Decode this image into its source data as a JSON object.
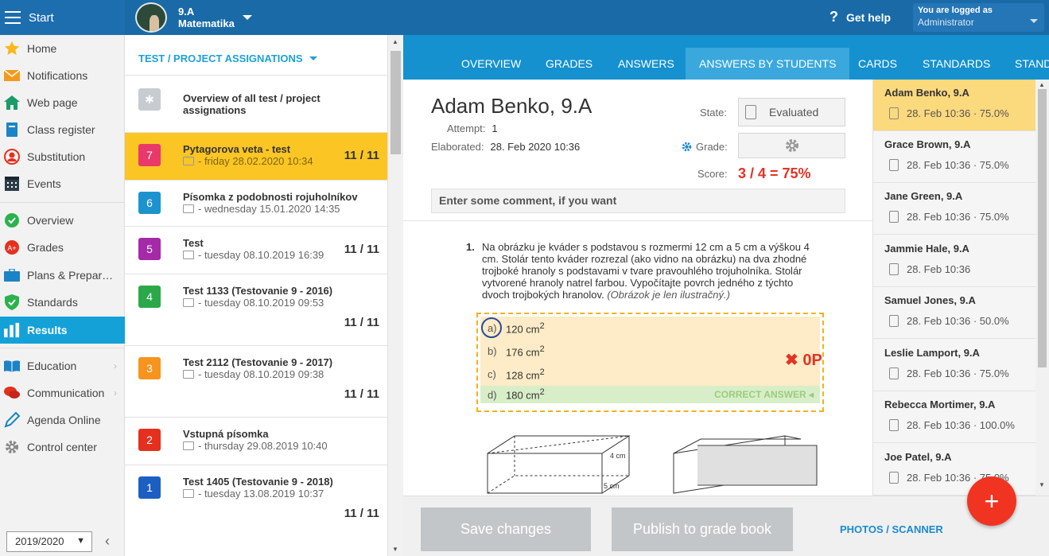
{
  "topbar": {
    "start_label": "Start",
    "class_name": "9.A",
    "subject": "Matematika",
    "help_label": "Get help",
    "logged_label": "You are logged as",
    "logged_user": "Administrator"
  },
  "sidebar": {
    "items": [
      {
        "label": "Home",
        "icon": "star-icon"
      },
      {
        "label": "Notifications",
        "icon": "envelope-icon"
      },
      {
        "label": "Web page",
        "icon": "house-icon"
      },
      {
        "label": "Class register",
        "icon": "book-icon"
      },
      {
        "label": "Substitution",
        "icon": "person-icon"
      },
      {
        "label": "Events",
        "icon": "calendar-icon"
      },
      {
        "label": "Overview",
        "icon": "check-circle-icon"
      },
      {
        "label": "Grades",
        "icon": "grade-icon"
      },
      {
        "label": "Plans & Preparations",
        "icon": "briefcase-icon"
      },
      {
        "label": "Standards",
        "icon": "shield-icon"
      },
      {
        "label": "Results",
        "icon": "bar-chart-icon"
      },
      {
        "label": "Education",
        "icon": "open-book-icon"
      },
      {
        "label": "Communication",
        "icon": "chat-icon"
      },
      {
        "label": "Agenda Online",
        "icon": "pencil-icon"
      },
      {
        "label": "Control center",
        "icon": "gear-icon"
      }
    ],
    "year": "2019/2020"
  },
  "list": {
    "header": "TEST / PROJECT ASSIGNATIONS",
    "overview": "Overview of all test / project assignations",
    "rows": [
      {
        "num": "7",
        "title": "Pytagorova veta - test",
        "sub": "- friday 28.02.2020 10:34",
        "score": "11 / 11"
      },
      {
        "num": "6",
        "title": "Písomka z podobnosti rojuholníkov",
        "sub": "- wednesday 15.01.2020 14:35",
        "score": ""
      },
      {
        "num": "5",
        "title": "Test",
        "sub": "- tuesday 08.10.2019 16:39",
        "score": "11 / 11"
      },
      {
        "num": "4",
        "title": "Test 1133 (Testovanie 9 - 2016)",
        "sub": "- tuesday 08.10.2019 09:53",
        "score": "11 / 11"
      },
      {
        "num": "3",
        "title": "Test 2112 (Testovanie 9 - 2017)",
        "sub": "- tuesday 08.10.2019 09:38",
        "score": "11 / 11"
      },
      {
        "num": "2",
        "title": "Vstupná písomka",
        "sub": "- thursday 29.08.2019 10:40",
        "score": ""
      },
      {
        "num": "1",
        "title": "Test 1405 (Testovanie 9 - 2018)",
        "sub": "- tuesday 13.08.2019 10:37",
        "score": "11 / 11"
      }
    ],
    "colors": [
      "#e9386a",
      "#1c93cf",
      "#a42aa8",
      "#2ba84a",
      "#f7941d",
      "#e5301f",
      "#1d5ec3"
    ]
  },
  "tabs": [
    "OVERVIEW",
    "GRADES",
    "ANSWERS",
    "ANSWERS BY STUDENTS",
    "CARDS",
    "STANDARDS",
    "STAND"
  ],
  "detail": {
    "name": "Adam Benko, 9.A",
    "attempt_label": "Attempt:",
    "attempt": "1",
    "elaborated_label": "Elaborated:",
    "elaborated": "28. Feb 2020 10:36",
    "state_label": "State:",
    "state": "Evaluated",
    "grade_label": "Grade:",
    "score_label": "Score:",
    "score": "3 / 4 = 75%",
    "comment_placeholder": "Enter some comment, if you want"
  },
  "question": {
    "num": "1.",
    "text": "Na obrázku je kváder s podstavou s rozmermi 12 cm a 5 cm a výškou 4 cm. Stolár tento kváder rozrezal (ako vidno na obrázku) na dva zhodné trojboké hranoly s podstavami v tvare pravouhlého trojuholníka. Stolár vytvorené hranoly natrel farbou. Vypočítajte povrch jedného z týchto dvoch trojbokých hranolov.",
    "note": "(Obrázok je len ilustračný.)",
    "answers": [
      {
        "letter": "a)",
        "value": "120 cm",
        "sup": "2"
      },
      {
        "letter": "b)",
        "value": "176 cm",
        "sup": "2"
      },
      {
        "letter": "c)",
        "value": "128 cm",
        "sup": "2"
      },
      {
        "letter": "d)",
        "value": "180 cm",
        "sup": "2"
      }
    ],
    "correct_label": "CORRECT ANSWER",
    "points": "0P",
    "fig_height": "4 cm",
    "fig_depth": "5 cm"
  },
  "students": [
    {
      "name": "Adam Benko, 9.A",
      "info": "28. Feb 10:36 · 75.0%"
    },
    {
      "name": "Grace Brown, 9.A",
      "info": "28. Feb 10:36 · 75.0%"
    },
    {
      "name": "Jane Green, 9.A",
      "info": "28. Feb 10:36 · 75.0%"
    },
    {
      "name": "Jammie Hale, 9.A",
      "info": "28. Feb 10:36"
    },
    {
      "name": "Samuel Jones, 9.A",
      "info": "28. Feb 10:36 · 50.0%"
    },
    {
      "name": "Leslie Lamport, 9.A",
      "info": "28. Feb 10:36 · 75.0%"
    },
    {
      "name": "Rebecca Mortimer, 9.A",
      "info": "28. Feb 10:36 · 100.0%"
    },
    {
      "name": "Joe Patel, 9.A",
      "info": "28. Feb 10:36 · 75.0%"
    }
  ],
  "bottom": {
    "save": "Save changes",
    "publish": "Publish to grade book",
    "photos": "PHOTOS / SCANNER",
    "fab": "+"
  }
}
